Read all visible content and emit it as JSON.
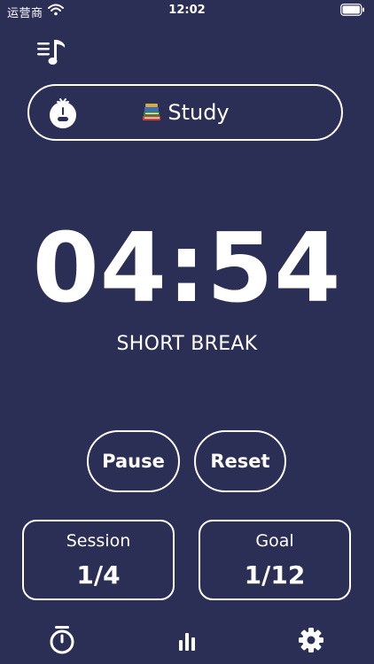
{
  "status_bar": {
    "carrier": "运营商",
    "time": "12:02"
  },
  "icons": {
    "music": "music-list-icon",
    "tomato": "tomato-icon",
    "tag_emoji": "books-icon",
    "timer_tab": "stopwatch-icon",
    "stats_tab": "bar-chart-icon",
    "settings_tab": "gear-icon"
  },
  "tag": {
    "label": "Study"
  },
  "timer": {
    "time": "04:54",
    "mode": "SHORT BREAK"
  },
  "controls": {
    "pause_label": "Pause",
    "reset_label": "Reset"
  },
  "stats": {
    "session_label": "Session",
    "session_value": "1/4",
    "goal_label": "Goal",
    "goal_value": "1/12"
  },
  "colors": {
    "background": "#2c2f55",
    "foreground": "#ffffff"
  }
}
